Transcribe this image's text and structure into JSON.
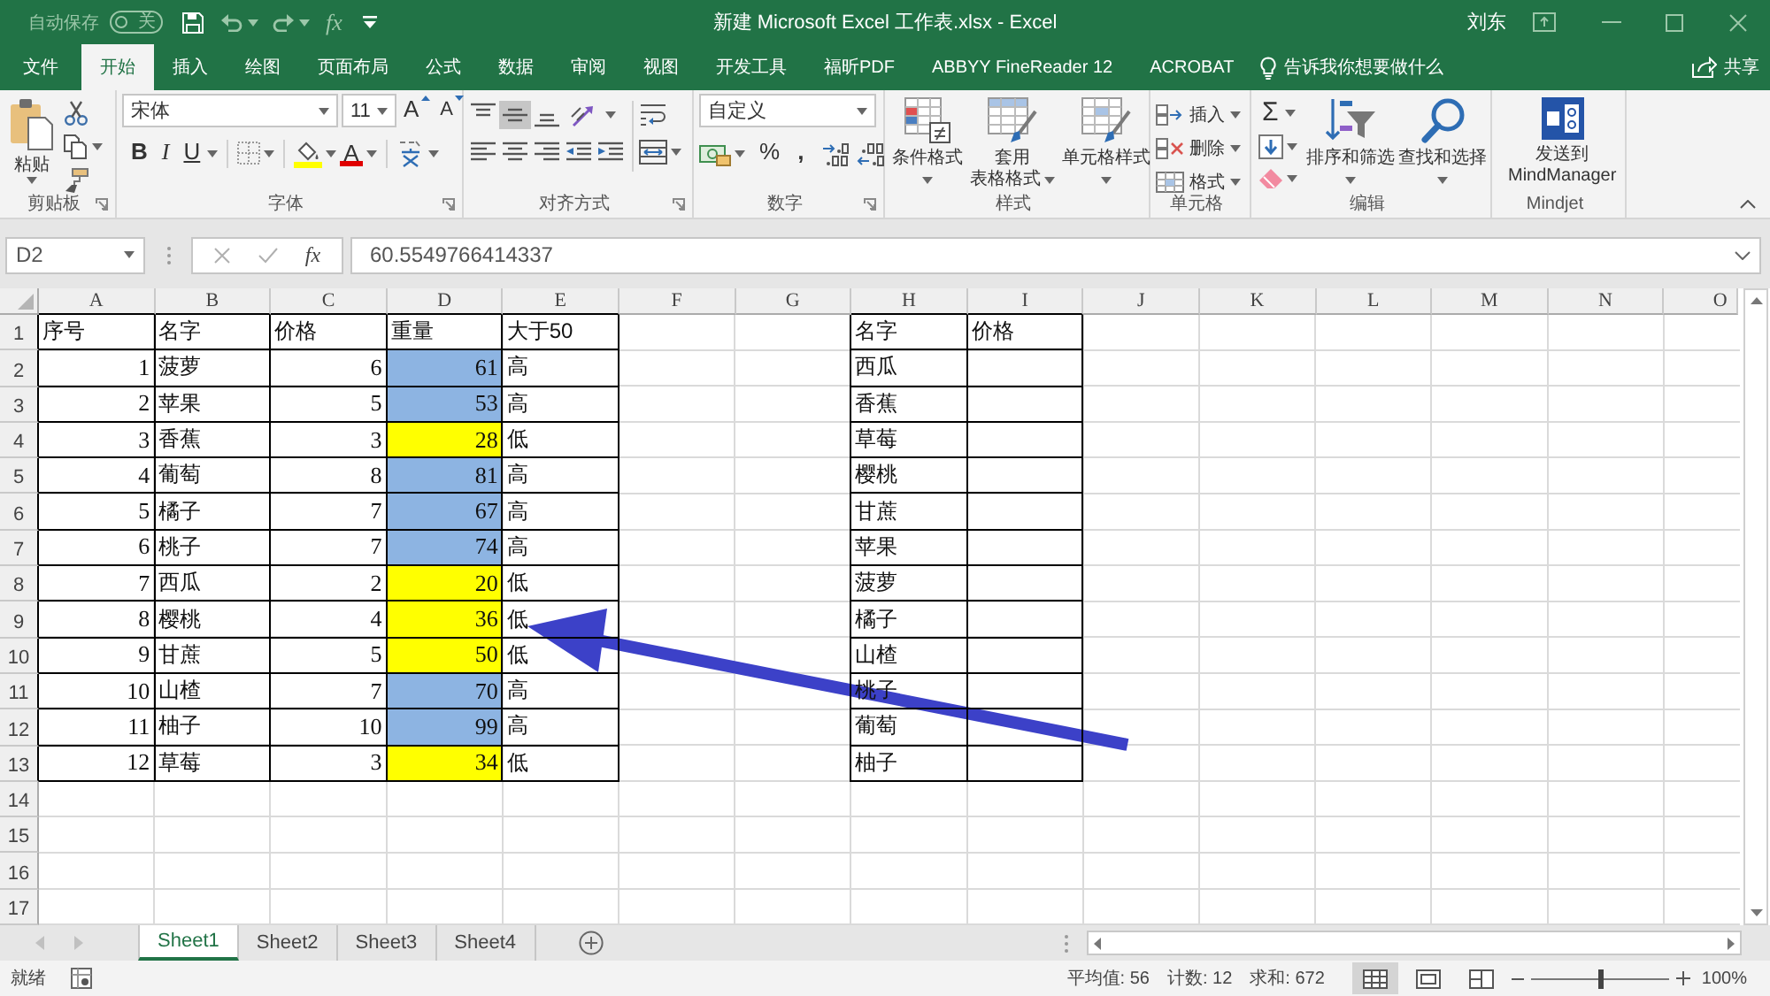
{
  "title_bar": {
    "autosave": {
      "label": "自动保存",
      "state": "关",
      "on": false
    },
    "function_button": "fx",
    "title": "新建 Microsoft Excel 工作表.xlsx - Excel",
    "user": "刘东"
  },
  "menu_tabs": [
    {
      "label": "文件",
      "selected": false
    },
    {
      "label": "开始",
      "selected": true
    },
    {
      "label": "插入",
      "selected": false
    },
    {
      "label": "绘图",
      "selected": false
    },
    {
      "label": "页面布局",
      "selected": false
    },
    {
      "label": "公式",
      "selected": false
    },
    {
      "label": "数据",
      "selected": false
    },
    {
      "label": "审阅",
      "selected": false
    },
    {
      "label": "视图",
      "selected": false
    },
    {
      "label": "开发工具",
      "selected": false
    },
    {
      "label": "福昕PDF",
      "selected": false
    },
    {
      "label": "ABBYY FineReader 12",
      "selected": false
    },
    {
      "label": "ACROBAT",
      "selected": false
    }
  ],
  "tell_me": {
    "placeholder": "告诉我你想要做什么"
  },
  "share": {
    "label": "共享"
  },
  "ribbon_groups": [
    {
      "kind": "clipboard",
      "label": "剪贴板",
      "paste": "粘贴"
    },
    {
      "kind": "font",
      "label": "字体",
      "font_name": "宋体",
      "font_size": "11",
      "grow": "A",
      "shrink": "A",
      "bold": "B",
      "italic": "I",
      "underline": "U",
      "font_color": "A"
    },
    {
      "kind": "alignment",
      "label": "对齐方式",
      "vertical": [
        {
          "selected": false
        },
        {
          "selected": true
        },
        {
          "selected": false
        }
      ]
    },
    {
      "kind": "number",
      "label": "数字",
      "format": "自定义",
      "percent": "%",
      "comma": ","
    },
    {
      "kind": "styles",
      "label": "样式",
      "buttons": [
        [
          "条件格式"
        ],
        [
          "套用",
          "表格格式"
        ],
        [
          "单元格样式"
        ]
      ]
    },
    {
      "kind": "cells",
      "label": "单元格",
      "buttons": [
        "插入",
        "删除",
        "格式"
      ]
    },
    {
      "kind": "editing",
      "label": "编辑",
      "autosum": "Σ",
      "buttons": [
        "排序和筛选",
        "查找和选择"
      ]
    },
    {
      "kind": "addin",
      "label": "Mindjet",
      "button": [
        "发送到",
        "MindManager"
      ]
    }
  ],
  "formula_bar": {
    "name_box": "D2",
    "insert_function": "fx",
    "formula": "60.5549766414337"
  },
  "sheet": {
    "columns": [
      "A",
      "B",
      "C",
      "D",
      "E",
      "F",
      "G",
      "H",
      "I",
      "J",
      "K",
      "L",
      "M",
      "N",
      "O"
    ],
    "rows": [
      "1",
      "2",
      "3",
      "4",
      "5",
      "6",
      "7",
      "8",
      "9",
      "10",
      "11",
      "12",
      "13",
      "14",
      "15",
      "16",
      "17"
    ],
    "table_1": {
      "header": [
        "序号",
        "名字",
        "价格",
        "重量",
        "大于50"
      ],
      "rows": [
        {
          "no": "1",
          "name": "菠萝",
          "price": "6",
          "weight": "61",
          "color": "#8db4e2",
          "above_50": "高"
        },
        {
          "no": "2",
          "name": "苹果",
          "price": "5",
          "weight": "53",
          "color": "#8db4e2",
          "above_50": "高"
        },
        {
          "no": "3",
          "name": "香蕉",
          "price": "3",
          "weight": "28",
          "color": "#ffff00",
          "above_50": "低"
        },
        {
          "no": "4",
          "name": "葡萄",
          "price": "8",
          "weight": "81",
          "color": "#8db4e2",
          "above_50": "高"
        },
        {
          "no": "5",
          "name": "橘子",
          "price": "7",
          "weight": "67",
          "color": "#8db4e2",
          "above_50": "高"
        },
        {
          "no": "6",
          "name": "桃子",
          "price": "7",
          "weight": "74",
          "color": "#8db4e2",
          "above_50": "高"
        },
        {
          "no": "7",
          "name": "西瓜",
          "price": "2",
          "weight": "20",
          "color": "#ffff00",
          "above_50": "低"
        },
        {
          "no": "8",
          "name": "樱桃",
          "price": "4",
          "weight": "36",
          "color": "#ffff00",
          "above_50": "低"
        },
        {
          "no": "9",
          "name": "甘蔗",
          "price": "5",
          "weight": "50",
          "color": "#ffff00",
          "above_50": "低"
        },
        {
          "no": "10",
          "name": "山楂",
          "price": "7",
          "weight": "70",
          "color": "#8db4e2",
          "above_50": "高"
        },
        {
          "no": "11",
          "name": "柚子",
          "price": "10",
          "weight": "99",
          "color": "#8db4e2",
          "above_50": "高"
        },
        {
          "no": "12",
          "name": "草莓",
          "price": "3",
          "weight": "34",
          "color": "#ffff00",
          "above_50": "低"
        }
      ]
    },
    "table_2": {
      "header": [
        "名字",
        "价格"
      ],
      "rows": [
        {
          "name": "西瓜"
        },
        {
          "name": "香蕉"
        },
        {
          "name": "草莓"
        },
        {
          "name": "樱桃"
        },
        {
          "name": "甘蔗"
        },
        {
          "name": "苹果"
        },
        {
          "name": "菠萝"
        },
        {
          "name": "橘子"
        },
        {
          "name": "山楂"
        },
        {
          "name": "桃子"
        },
        {
          "name": "葡萄"
        },
        {
          "name": "柚子"
        }
      ]
    }
  },
  "sheet_tabs": [
    {
      "label": "Sheet1",
      "selected": true
    },
    {
      "label": "Sheet2",
      "selected": false
    },
    {
      "label": "Sheet3",
      "selected": false
    },
    {
      "label": "Sheet4",
      "selected": false
    }
  ],
  "status_bar": {
    "status": "就绪",
    "average": "平均值: 56",
    "count": "计数: 12",
    "sum": "求和: 672",
    "view_buttons": [
      {
        "selected": true
      },
      {
        "selected": false
      },
      {
        "selected": false
      }
    ],
    "zoom": {
      "level": 0.5,
      "reading": "100%"
    }
  }
}
